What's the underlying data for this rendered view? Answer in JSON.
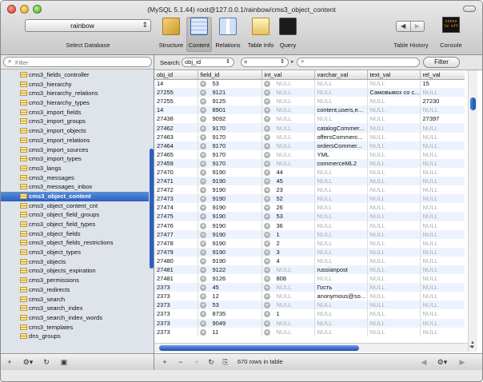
{
  "window": {
    "title": "(MySQL 5.1.44) root@127.0.0.1/rainbow/cms3_object_content"
  },
  "toolbar": {
    "database_value": "rainbow",
    "database_label": "Select Database",
    "buttons": [
      {
        "label": "Structure",
        "icon": "structure-icon"
      },
      {
        "label": "Content",
        "icon": "content-icon"
      },
      {
        "label": "Relations",
        "icon": "relations-icon"
      },
      {
        "label": "Table Info",
        "icon": "table-info-icon"
      },
      {
        "label": "Query",
        "icon": "query-icon"
      }
    ],
    "history_label": "Table History",
    "console_label": "Console",
    "console_icon_text": "conso le off"
  },
  "sidebar": {
    "filter_placeholder": "Filter",
    "selected_table": "cms3_object_content",
    "tables": [
      "cms3_fields_controller",
      "cms3_hierarchy",
      "cms3_hierarchy_relations",
      "cms3_hierarchy_types",
      "cms3_import_fields",
      "cms3_import_groups",
      "cms3_import_objects",
      "cms3_import_relations",
      "cms3_import_sources",
      "cms3_import_types",
      "cms3_langs",
      "cms3_messages",
      "cms3_messages_inbox",
      "cms3_object_content",
      "cms3_object_content_cnt",
      "cms3_object_field_groups",
      "cms3_object_field_types",
      "cms3_object_fields",
      "cms3_object_fields_restrictions",
      "cms3_object_types",
      "cms3_objects",
      "cms3_objects_expiration",
      "cms3_permissions",
      "cms3_redirects",
      "cms3_search",
      "cms3_search_index",
      "cms3_search_index_words",
      "cms3_templates",
      "dns_groups"
    ]
  },
  "search": {
    "label": "Search:",
    "field_value": "obj_id",
    "operator_value": "=",
    "query_value": "",
    "filter_button": "Filter"
  },
  "table": {
    "columns": [
      "obj_id",
      "field_id",
      "int_val",
      "varchar_val",
      "text_val",
      "rel_val"
    ],
    "rows": [
      [
        "14",
        "53",
        "NULL",
        "NULL",
        "NULL",
        "15"
      ],
      [
        "27255",
        "9121",
        "NULL",
        "NULL",
        "Самовывоз со с...",
        "NULL"
      ],
      [
        "27255",
        "9125",
        "NULL",
        "NULL",
        "NULL",
        "27230"
      ],
      [
        "14",
        "8901",
        "NULL",
        "content,users,e...",
        "NULL",
        "NULL"
      ],
      [
        "27438",
        "9092",
        "NULL",
        "NULL",
        "NULL",
        "27397"
      ],
      [
        "27462",
        "9170",
        "NULL",
        "catalogCommer...",
        "NULL",
        "NULL"
      ],
      [
        "27463",
        "9170",
        "NULL",
        "offersCommerc...",
        "NULL",
        "NULL"
      ],
      [
        "27464",
        "9170",
        "NULL",
        "ordersCommer...",
        "NULL",
        "NULL"
      ],
      [
        "27465",
        "9170",
        "NULL",
        "YML",
        "NULL",
        "NULL"
      ],
      [
        "27459",
        "9170",
        "NULL",
        "commerceML2",
        "NULL",
        "NULL"
      ],
      [
        "27470",
        "9190",
        "44",
        "NULL",
        "NULL",
        "NULL"
      ],
      [
        "27471",
        "9190",
        "45",
        "NULL",
        "NULL",
        "NULL"
      ],
      [
        "27472",
        "9190",
        "23",
        "NULL",
        "NULL",
        "NULL"
      ],
      [
        "27473",
        "9190",
        "52",
        "NULL",
        "NULL",
        "NULL"
      ],
      [
        "27474",
        "9190",
        "26",
        "NULL",
        "NULL",
        "NULL"
      ],
      [
        "27475",
        "9190",
        "53",
        "NULL",
        "NULL",
        "NULL"
      ],
      [
        "27476",
        "9190",
        "36",
        "NULL",
        "NULL",
        "NULL"
      ],
      [
        "27477",
        "9190",
        "1",
        "NULL",
        "NULL",
        "NULL"
      ],
      [
        "27478",
        "9190",
        "2",
        "NULL",
        "NULL",
        "NULL"
      ],
      [
        "27479",
        "9190",
        "3",
        "NULL",
        "NULL",
        "NULL"
      ],
      [
        "27480",
        "9190",
        "4",
        "NULL",
        "NULL",
        "NULL"
      ],
      [
        "27481",
        "9122",
        "NULL",
        "russianpost",
        "NULL",
        "NULL"
      ],
      [
        "27481",
        "9126",
        "808",
        "NULL",
        "NULL",
        "NULL"
      ],
      [
        "2373",
        "45",
        "NULL",
        "Гость",
        "NULL",
        "NULL"
      ],
      [
        "2373",
        "12",
        "NULL",
        "anonymous@so...",
        "NULL",
        "NULL"
      ],
      [
        "2373",
        "53",
        "NULL",
        "NULL",
        "NULL",
        "NULL"
      ],
      [
        "2373",
        "8735",
        "1",
        "NULL",
        "NULL",
        "NULL"
      ],
      [
        "2373",
        "9049",
        "NULL",
        "NULL",
        "NULL",
        "NULL"
      ],
      [
        "2373",
        "11",
        "NULL",
        "NULL",
        "NULL",
        "NULL"
      ]
    ]
  },
  "status": {
    "row_count": "670 rows in table"
  }
}
